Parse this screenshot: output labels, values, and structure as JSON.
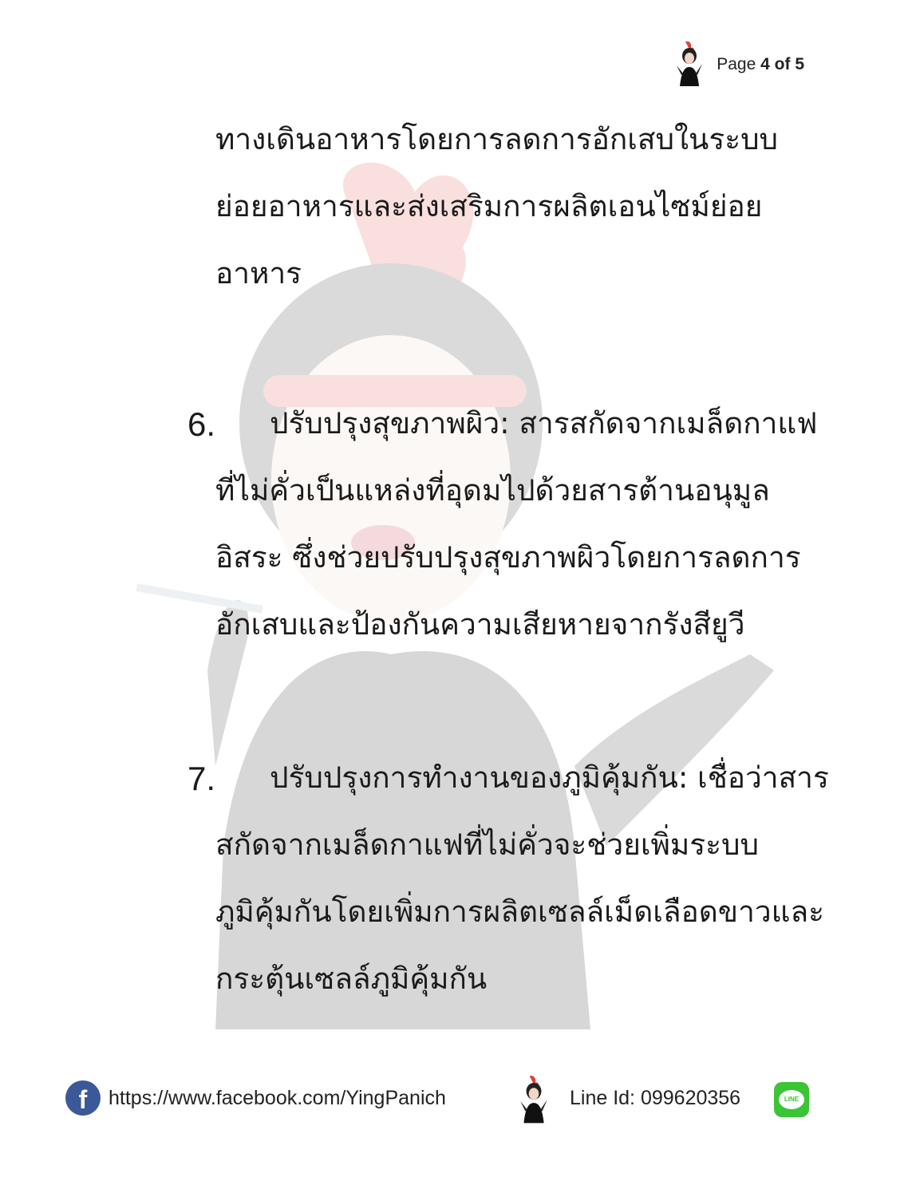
{
  "header": {
    "page_prefix": "Page",
    "current_page": "4",
    "of_word": "of",
    "total_pages": "5",
    "mascot_icon": "lady-mascot-icon"
  },
  "body": {
    "continuation": [
      "ทางเดินอาหารโดยการลดการอักเสบในระบบ",
      "ย่อยอาหารและส่งเสริมการผลิตเอนไซม์ย่อย",
      "อาหาร"
    ],
    "item6": {
      "number": "6.",
      "lines": [
        "ปรับปรุงสุขภาพผิว: สารสกัดจากเมล็ดกาแฟ",
        "ที่ไม่คั่วเป็นแหล่งที่อุดมไปด้วยสารต้านอนุมูล",
        "อิสระ ซึ่งช่วยปรับปรุงสุขภาพผิวโดยการลดการ",
        "อักเสบและป้องกันความเสียหายจากรังสียูวี"
      ]
    },
    "item7": {
      "number": "7.",
      "lines": [
        "ปรับปรุงการทำงานของภูมิคุ้มกัน: เชื่อว่าสาร",
        "สกัดจากเมล็ดกาแฟที่ไม่คั่วจะช่วยเพิ่มระบบ",
        "ภูมิคุ้มกันโดยเพิ่มการผลิตเซลล์เม็ดเลือดขาวและ",
        "กระตุ้นเซลล์ภูมิคุ้มกัน"
      ]
    }
  },
  "footer": {
    "facebook_icon_letter": "f",
    "facebook_url": "https://www.facebook.com/YingPanich",
    "line_id": "Line Id: 099620356",
    "line_icon_text": "LINE",
    "colors": {
      "facebook": "#3b5998",
      "line": "#3bc436"
    }
  },
  "watermark": {
    "icon": "lady-mascot-watermark",
    "colors": {
      "feather": "#e0413a",
      "hair": "#222222"
    }
  }
}
